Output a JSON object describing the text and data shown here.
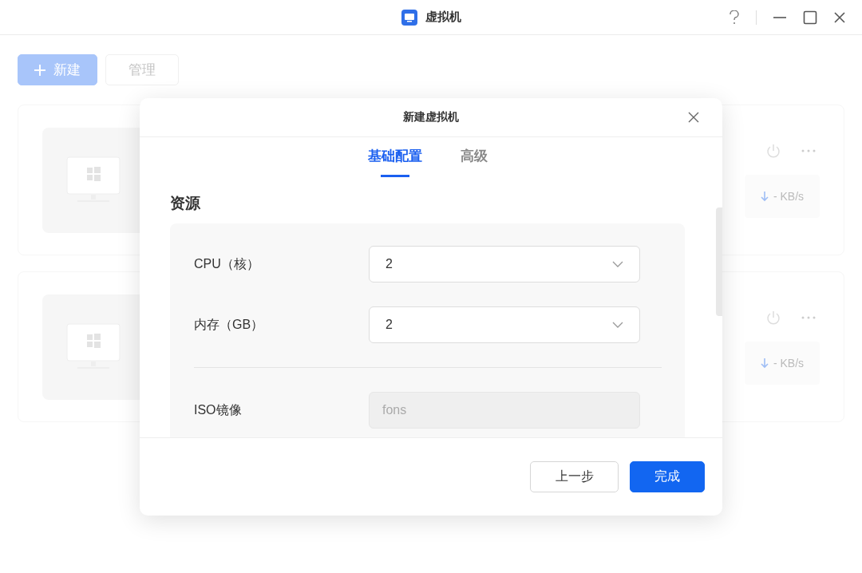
{
  "window": {
    "title": "虚拟机"
  },
  "toolbar": [
    {
      "label": "新建",
      "kind": "primary"
    },
    {
      "label": "管理",
      "kind": "default"
    }
  ],
  "vm_cards": [
    {
      "speed": "- KB/s"
    },
    {
      "speed": "- KB/s"
    }
  ],
  "dialog": {
    "title": "新建虚拟机",
    "tabs": [
      {
        "label": "基础配置",
        "selected": true
      },
      {
        "label": "高级",
        "selected": false
      }
    ],
    "section": "资源",
    "fields": [
      {
        "label": "CPU（核）",
        "kind": "select",
        "value": "2",
        "disabled": false
      },
      {
        "label": "内存（GB）",
        "kind": "select",
        "value": "2",
        "disabled": false
      },
      {
        "kind": "divider"
      },
      {
        "label": "ISO镜像",
        "kind": "text",
        "value": "fons",
        "disabled": true
      }
    ],
    "buttons": [
      {
        "label": "上一步",
        "kind": "default"
      },
      {
        "label": "完成",
        "kind": "primary"
      }
    ]
  }
}
